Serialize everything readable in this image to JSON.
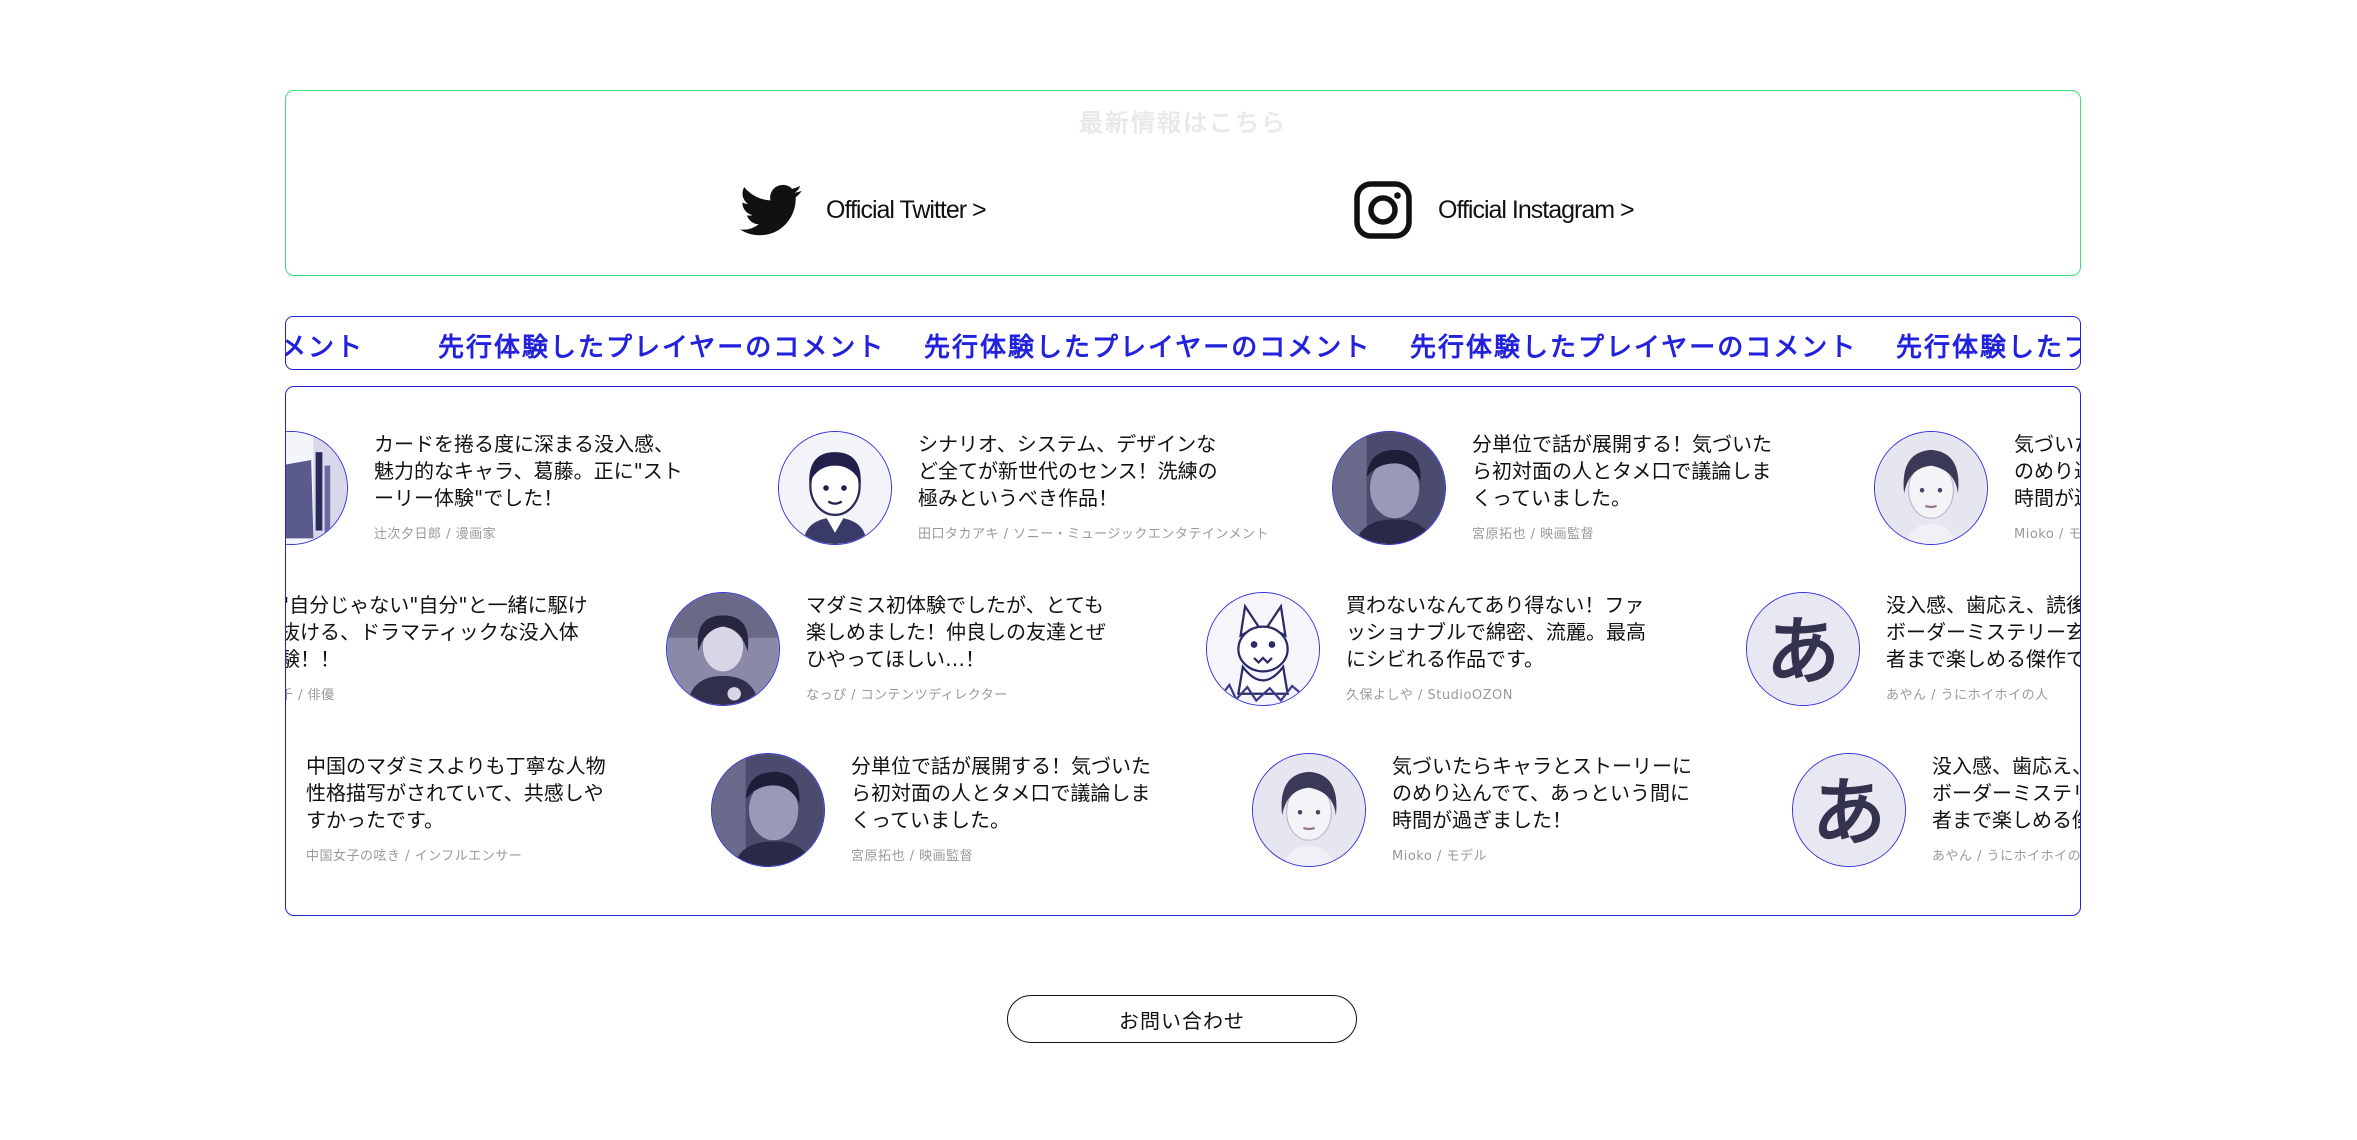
{
  "social": {
    "heading": "最新情報はこちら",
    "twitter": {
      "label": "Official Twitter >",
      "icon": "twitter-bird-icon"
    },
    "instagram": {
      "label": "Official Instagram >",
      "icon": "instagram-icon"
    }
  },
  "marquee": {
    "text": "先行体験したプレイヤーのコメント",
    "leading_fragment": "メント",
    "trailing_fragment": "先行体験したプレ"
  },
  "comments": [
    {
      "text": "カードを捲る度に深まる没入感、魅力的なキャラ、葛藤。正に\"ストーリー体験\"でした！",
      "author": "辻次夕日郎 / 漫画家",
      "avatar": "manga-cover"
    },
    {
      "text": "シナリオ、システム、デザインなど全てが新世代のセンス！洗練の極みというべき作品！",
      "author": "田口タカアキ / ソニー・ミュージックエンタテインメント",
      "avatar": "cartoon-man"
    },
    {
      "text": "分単位で話が展開する！気づいたら初対面の人とタメ口で議論しまくっていました。",
      "author": "宮原拓也 / 映画監督",
      "avatar": "photo-man"
    },
    {
      "text": "気づいたらキャラとストーリーにのめり込んでて、あっという間に時間が過ぎました！",
      "author": "Mioko / モデル",
      "avatar": "photo-woman"
    },
    {
      "text": "\"自分じゃない\"自分\"と一緒に駆け抜ける、ドラマティックな没入体験！！",
      "author": "千 / 俳優",
      "avatar": "none"
    },
    {
      "text": "マダミス初体験でしたが、とても楽しめました！仲良しの友達とぜひやってほしい…！",
      "author": "なっぴ / コンテンツディレクター",
      "avatar": "photo-woman-short-hair"
    },
    {
      "text": "買わないなんてあり得ない！ファッショナブルで綿密、流麗。最高にシビれる作品です。",
      "author": "久保よしや / StudioOZON",
      "avatar": "wolf-illustration"
    },
    {
      "text": "没入感、歯応え、読後感が秀逸なボーダーミステリー玄人から初心者まで楽しめる傑作です！",
      "author": "あやん / うにホイホイの人",
      "avatar": "hiragana-a"
    },
    {
      "text": "中国のマダミスよりも丁寧な人物性格描写がされていて、共感しやすかったです。",
      "author": "中国女子の呟き / インフルエンサー",
      "avatar": "none"
    },
    {
      "text": "分単位で話が展開する！気づいたら初対面の人とタメ口で議論しまくっていました。",
      "author": "宮原拓也 / 映画監督",
      "avatar": "photo-man"
    },
    {
      "text": "気づいたらキャラとストーリーにのめり込んでて、あっという間に時間が過ぎました！",
      "author": "Mioko / モデル",
      "avatar": "photo-woman"
    },
    {
      "text": "没入感、歯応え、読後感が秀逸なボーダーミステリー玄人から初心者まで楽しめる傑作です！",
      "author": "あやん / うにホイホイの人",
      "avatar": "hiragana-a"
    }
  ],
  "contact": {
    "label": "お問い合わせ"
  },
  "colors": {
    "accent": "#2222dd",
    "social_border": "#3ee07a",
    "avatar_bg": "#ececf6"
  }
}
